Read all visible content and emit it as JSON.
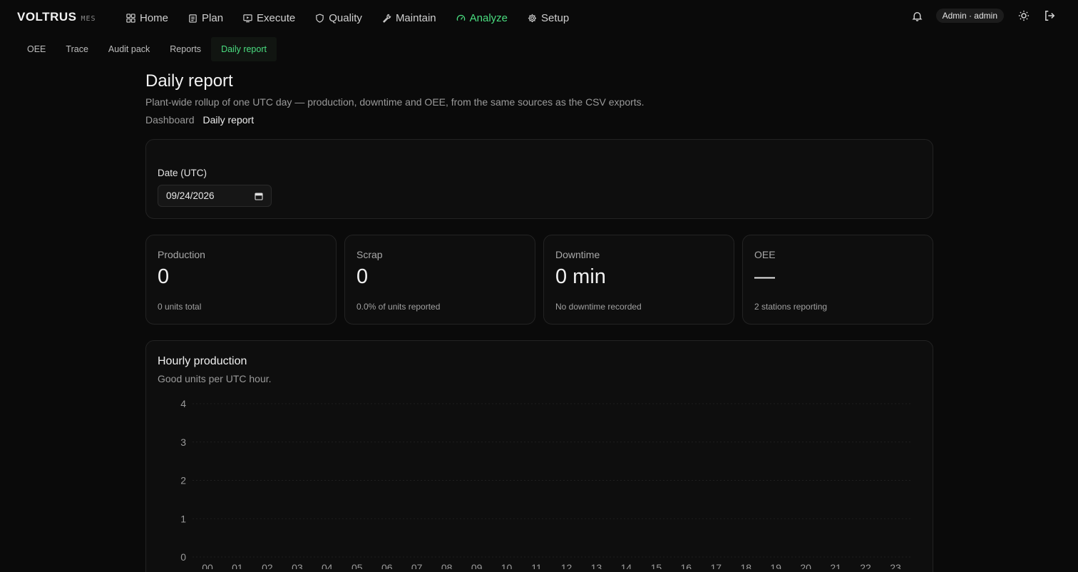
{
  "brand": {
    "name": "VOLTRUS",
    "sub": "MES"
  },
  "nav": [
    {
      "label": "Home",
      "icon": "grid-icon"
    },
    {
      "label": "Plan",
      "icon": "clipboard-icon"
    },
    {
      "label": "Execute",
      "icon": "monitor-play-icon"
    },
    {
      "label": "Quality",
      "icon": "shield-icon"
    },
    {
      "label": "Maintain",
      "icon": "wrench-icon"
    },
    {
      "label": "Analyze",
      "icon": "gauge-icon",
      "active": true
    },
    {
      "label": "Setup",
      "icon": "gear-icon"
    }
  ],
  "user": {
    "chip": "Admin · admin"
  },
  "subnav": [
    {
      "label": "OEE"
    },
    {
      "label": "Trace"
    },
    {
      "label": "Audit pack"
    },
    {
      "label": "Reports"
    },
    {
      "label": "Daily report",
      "active": true
    }
  ],
  "page": {
    "title": "Daily report",
    "description": "Plant-wide rollup of one UTC day — production, downtime and OEE, from the same sources as the CSV exports.",
    "breadcrumb": [
      "Dashboard",
      "Daily report"
    ]
  },
  "date_filter": {
    "label": "Date (UTC)",
    "value": "09/24/2026"
  },
  "stats": [
    {
      "label": "Production",
      "value": "0",
      "sub": "0 units total"
    },
    {
      "label": "Scrap",
      "value": "0",
      "sub": "0.0% of units reported"
    },
    {
      "label": "Downtime",
      "value": "0 min",
      "sub": "No downtime recorded"
    },
    {
      "label": "OEE",
      "value": "—",
      "sub": "2 stations reporting"
    }
  ],
  "chart_section": {
    "title": "Hourly production",
    "description": "Good units per UTC hour."
  },
  "colors": {
    "accent": "#4ade80",
    "background": "#0a0a0a",
    "card": "#0e0e0e"
  },
  "chart_data": {
    "type": "bar",
    "title": "Hourly production",
    "xlabel": "",
    "ylabel": "",
    "categories": [
      "00",
      "01",
      "02",
      "03",
      "04",
      "05",
      "06",
      "07",
      "08",
      "09",
      "10",
      "11",
      "12",
      "13",
      "14",
      "15",
      "16",
      "17",
      "18",
      "19",
      "20",
      "21",
      "22",
      "23"
    ],
    "values": [
      0,
      0,
      0,
      0,
      0,
      0,
      0,
      0,
      0,
      0,
      0,
      0,
      0,
      0,
      0,
      0,
      0,
      0,
      0,
      0,
      0,
      0,
      0,
      0
    ],
    "yticks": [
      "0",
      "1",
      "2",
      "3",
      "4"
    ],
    "ylim": [
      0,
      4
    ],
    "grid": true
  }
}
